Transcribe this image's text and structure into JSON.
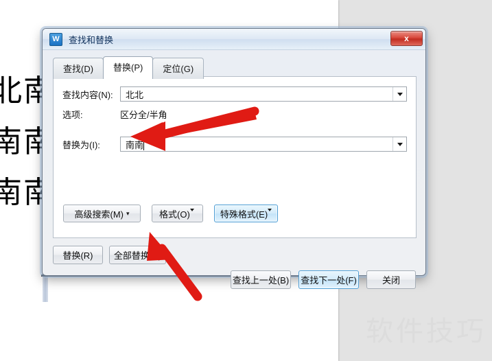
{
  "document": {
    "lines": [
      "北南",
      "南南",
      "南南"
    ],
    "watermark": "软件技巧"
  },
  "dialog": {
    "title": "查找和替换",
    "icon": "wps-w-icon",
    "close_label": "x",
    "tabs": [
      {
        "label": "查找(D)",
        "active": false,
        "name": "tab-find"
      },
      {
        "label": "替换(P)",
        "active": true,
        "name": "tab-replace"
      },
      {
        "label": "定位(G)",
        "active": false,
        "name": "tab-goto"
      }
    ],
    "fields": {
      "find_label": "查找内容(N):",
      "find_value": "北北",
      "options_label": "选项:",
      "options_value": "区分全/半角",
      "replace_label": "替换为(I):",
      "replace_value": "南南"
    },
    "mid_buttons": [
      {
        "label": "高级搜索(M)",
        "name": "advanced-search-button",
        "caret": "updown",
        "highlight": false
      },
      {
        "label": "格式(O)",
        "name": "format-button",
        "caret": "down-spaced",
        "highlight": false
      },
      {
        "label": "特殊格式(E)",
        "name": "special-format-button",
        "caret": "down",
        "highlight": true
      }
    ],
    "bottom_left_buttons": [
      {
        "label": "替换(R)",
        "name": "replace-button"
      },
      {
        "label": "全部替换(A)",
        "name": "replace-all-button"
      }
    ],
    "bottom_right_buttons": [
      {
        "label": "查找上一处(B)",
        "name": "find-previous-button",
        "highlight": false,
        "size": "wide"
      },
      {
        "label": "查找下一处(F)",
        "name": "find-next-button",
        "highlight": true,
        "size": "wide"
      },
      {
        "label": "关闭",
        "name": "close-dialog-button",
        "highlight": false,
        "size": "narrow"
      }
    ]
  },
  "annotations": {
    "arrow_color": "#e01b14",
    "arrow_1_target": "replace-input-field",
    "arrow_2_target": "replace-all-button"
  }
}
